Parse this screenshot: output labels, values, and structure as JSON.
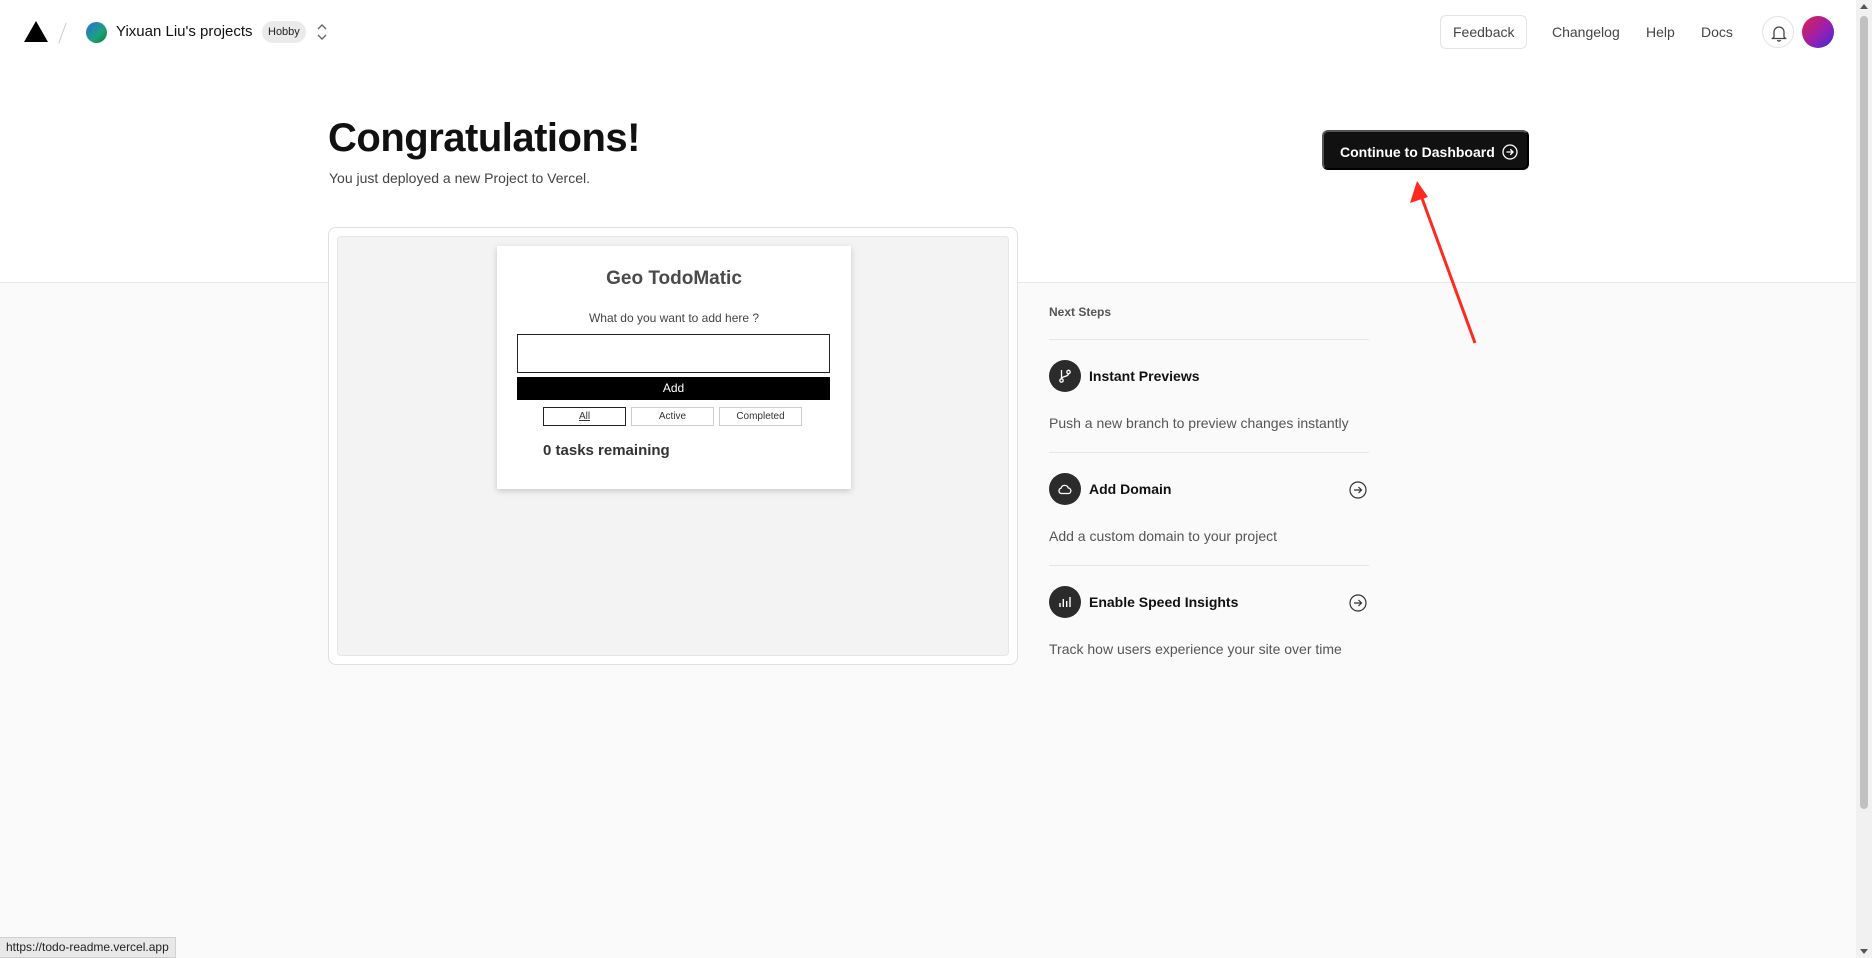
{
  "header": {
    "team_name": "Yixuan Liu's projects",
    "plan_badge": "Hobby",
    "feedback_label": "Feedback",
    "nav": [
      "Changelog",
      "Help",
      "Docs"
    ]
  },
  "hero": {
    "title": "Congratulations!",
    "subtitle": "You just deployed a new Project to Vercel.",
    "cta_label": "Continue to Dashboard"
  },
  "preview": {
    "app_title": "Geo TodoMatic",
    "prompt": "What do you want to add here ?",
    "input_value": "",
    "add_label": "Add",
    "filters": [
      "All",
      "Active",
      "Completed"
    ],
    "active_filter": "All",
    "tasks_remaining": "0 tasks remaining"
  },
  "next_steps": {
    "heading": "Next Steps",
    "items": [
      {
        "title": "Instant Previews",
        "description": "Push a new branch to preview changes instantly",
        "icon": "git-branch-icon",
        "has_arrow": false
      },
      {
        "title": "Add Domain",
        "description": "Add a custom domain to your project",
        "icon": "cloud-icon",
        "has_arrow": true
      },
      {
        "title": "Enable Speed Insights",
        "description": "Track how users experience your site over time",
        "icon": "bar-chart-icon",
        "has_arrow": true
      }
    ]
  },
  "status_bar": {
    "url": "https://todo-readme.vercel.app"
  },
  "colors": {
    "primary": "#111111",
    "annotation": "#ff2a1f",
    "background": "#fafafa"
  }
}
